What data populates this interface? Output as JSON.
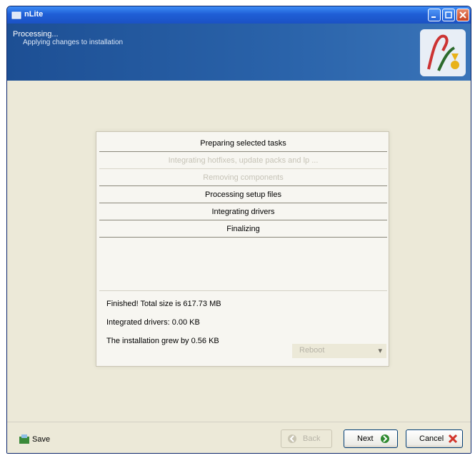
{
  "window": {
    "title": "nLite",
    "banner_title": "Processing...",
    "banner_subtitle": "Applying changes to installation"
  },
  "tasks": [
    {
      "label": "Preparing selected tasks",
      "state": "done"
    },
    {
      "label": "Integrating hotfixes, update packs and lp ...",
      "state": "pending"
    },
    {
      "label": "Removing components",
      "state": "pending"
    },
    {
      "label": "Processing setup files",
      "state": "done"
    },
    {
      "label": "Integrating drivers",
      "state": "done"
    },
    {
      "label": "Finalizing",
      "state": "done"
    }
  ],
  "info": {
    "line1": "Finished! Total size is 617.73 MB",
    "line2": "Integrated drivers: 0.00 KB",
    "line3": "The installation grew by 0.56 KB",
    "reboot_select": "Reboot"
  },
  "footer": {
    "save_label": "Save",
    "back_label": "Back",
    "next_label": "Next",
    "cancel_label": "Cancel"
  },
  "icons": {
    "app": "app-icon",
    "logo": "nlite-logo-icon",
    "save": "save-icon",
    "back": "back-arrow-icon",
    "next": "next-arrow-icon",
    "cancel": "cancel-x-icon"
  },
  "colors": {
    "titlebar": "#1f5fd6",
    "banner": "#2a63aa",
    "window_bg": "#ece9d8",
    "dim_text": "#c6c3b7"
  }
}
